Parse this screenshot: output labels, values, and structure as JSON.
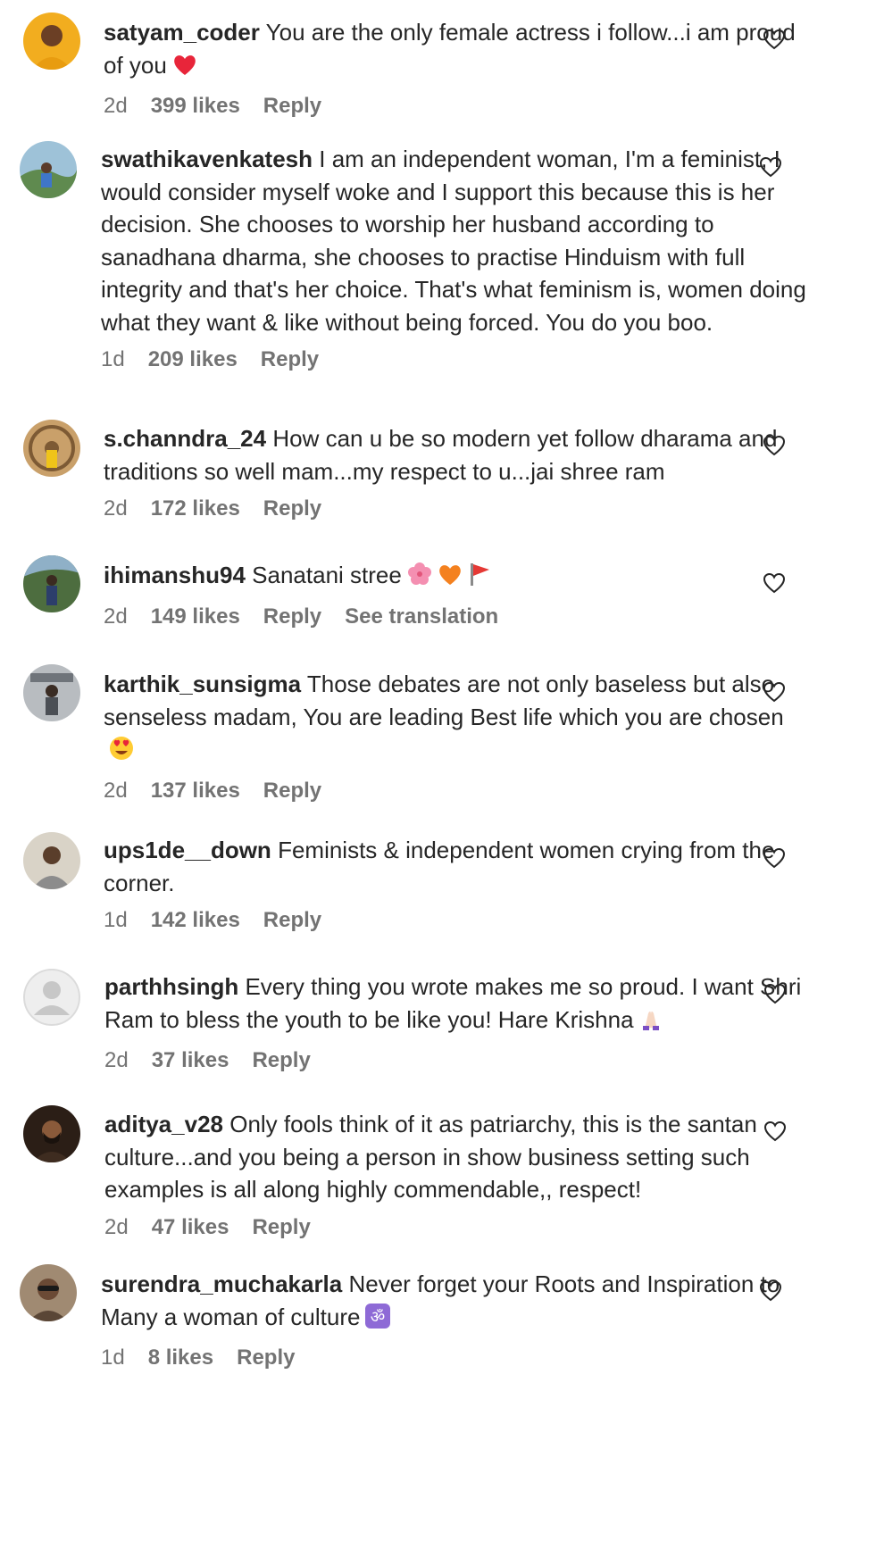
{
  "comments": [
    {
      "username": "satyam_coder",
      "text": "You are the only female actress i follow...i am proud of you",
      "emoji": "red-heart",
      "time": "2d",
      "likes": "399 likes",
      "reply": "Reply",
      "avatar_color": "#e3a21a"
    },
    {
      "username": "swathikavenkatesh",
      "text": "I am an independent woman, I'm a feminist, I would consider myself woke and I support this because this is her decision. She chooses to worship her husband according to sanadhana dharma, she chooses to practise Hinduism with full integrity and that's her choice. That's what feminism is, women doing what they want & like without being forced. You do you boo.",
      "time": "1d",
      "likes": "209 likes",
      "reply": "Reply",
      "avatar_color": "#6f9a6a"
    },
    {
      "username": "s.channdra_24",
      "text": "How can u be so modern yet follow dharama and traditions so well mam...my respect to u...jai shree ram",
      "time": "2d",
      "likes": "172 likes",
      "reply": "Reply",
      "avatar_color": "#b08a58"
    },
    {
      "username": "ihimanshu94",
      "text": "Sanatani stree",
      "emoji": "flower-orange-heart-flag",
      "time": "2d",
      "likes": "149 likes",
      "reply": "Reply",
      "translate": "See translation",
      "avatar_color": "#3f5e3a"
    },
    {
      "username": "karthik_sunsigma",
      "text": "Those debates are not only baseless but also senseless madam, You are leading Best life which you are chosen",
      "emoji": "heart-eyes",
      "time": "2d",
      "likes": "137 likes",
      "reply": "Reply",
      "avatar_color": "#7a7f86"
    },
    {
      "username": "ups1de__down",
      "text": "Feminists & independent women crying from the corner.",
      "time": "1d",
      "likes": "142 likes",
      "reply": "Reply",
      "avatar_color": "#9a8c78"
    },
    {
      "username": "parthhsingh",
      "text": "Every thing you wrote makes me so proud. I want Shri Ram to bless the youth to be like you! Hare Krishna",
      "emoji": "folded-hands",
      "time": "2d",
      "likes": "37 likes",
      "reply": "Reply",
      "avatar_color": "#dbdbdb"
    },
    {
      "username": "aditya_v28",
      "text": "Only fools think of it as patriarchy, this is the santan culture...and you being a person in show business setting such examples is all along highly commendable,, respect!",
      "time": "2d",
      "likes": "47 likes",
      "reply": "Reply",
      "avatar_color": "#3a2a1e"
    },
    {
      "username": "surendra_muchakarla",
      "text": "Never forget your Roots and Inspiration to Many a woman of culture",
      "emoji": "om-symbol",
      "time": "1d",
      "likes": "8 likes",
      "reply": "Reply",
      "avatar_color": "#8a7260"
    }
  ]
}
